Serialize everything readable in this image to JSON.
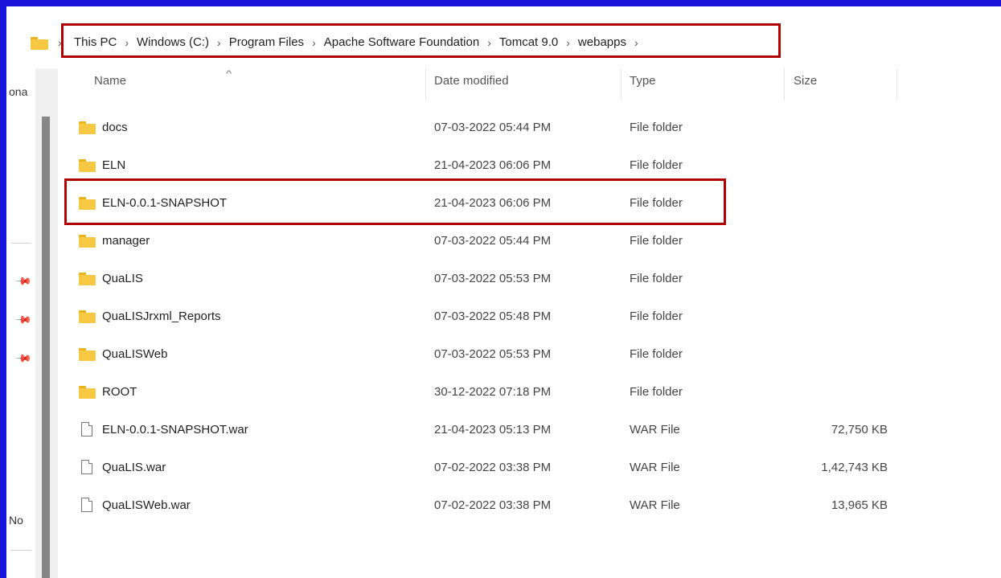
{
  "breadcrumb": [
    "This PC",
    "Windows (C:)",
    "Program Files",
    "Apache Software Foundation",
    "Tomcat 9.0",
    "webapps"
  ],
  "nav": {
    "top_text": "ona",
    "bottom_text": "No"
  },
  "columns": {
    "name": "Name",
    "date": "Date modified",
    "type": "Type",
    "size": "Size"
  },
  "rows": [
    {
      "name": "docs",
      "date": "07-03-2022 05:44 PM",
      "type": "File folder",
      "size": "",
      "icon": "folder-icon"
    },
    {
      "name": "ELN",
      "date": "21-04-2023 06:06 PM",
      "type": "File folder",
      "size": "",
      "icon": "folder-icon"
    },
    {
      "name": "ELN-0.0.1-SNAPSHOT",
      "date": "21-04-2023 06:06 PM",
      "type": "File folder",
      "size": "",
      "icon": "folder-icon"
    },
    {
      "name": "manager",
      "date": "07-03-2022 05:44 PM",
      "type": "File folder",
      "size": "",
      "icon": "folder-icon"
    },
    {
      "name": "QuaLIS",
      "date": "07-03-2022 05:53 PM",
      "type": "File folder",
      "size": "",
      "icon": "folder-icon"
    },
    {
      "name": "QuaLISJrxml_Reports",
      "date": "07-03-2022 05:48 PM",
      "type": "File folder",
      "size": "",
      "icon": "folder-icon"
    },
    {
      "name": "QuaLISWeb",
      "date": "07-03-2022 05:53 PM",
      "type": "File folder",
      "size": "",
      "icon": "folder-icon"
    },
    {
      "name": "ROOT",
      "date": "30-12-2022 07:18 PM",
      "type": "File folder",
      "size": "",
      "icon": "folder-icon"
    },
    {
      "name": "ELN-0.0.1-SNAPSHOT.war",
      "date": "21-04-2023 05:13 PM",
      "type": "WAR File",
      "size": "72,750 KB",
      "icon": "file-icon"
    },
    {
      "name": "QuaLIS.war",
      "date": "07-02-2022 03:38 PM",
      "type": "WAR File",
      "size": "1,42,743 KB",
      "icon": "file-icon"
    },
    {
      "name": "QuaLISWeb.war",
      "date": "07-02-2022 03:38 PM",
      "type": "WAR File",
      "size": "13,965 KB",
      "icon": "file-icon"
    }
  ],
  "colors": {
    "frame": "#1a14d8",
    "highlight": "#b00000",
    "folder": "#f7c844"
  }
}
